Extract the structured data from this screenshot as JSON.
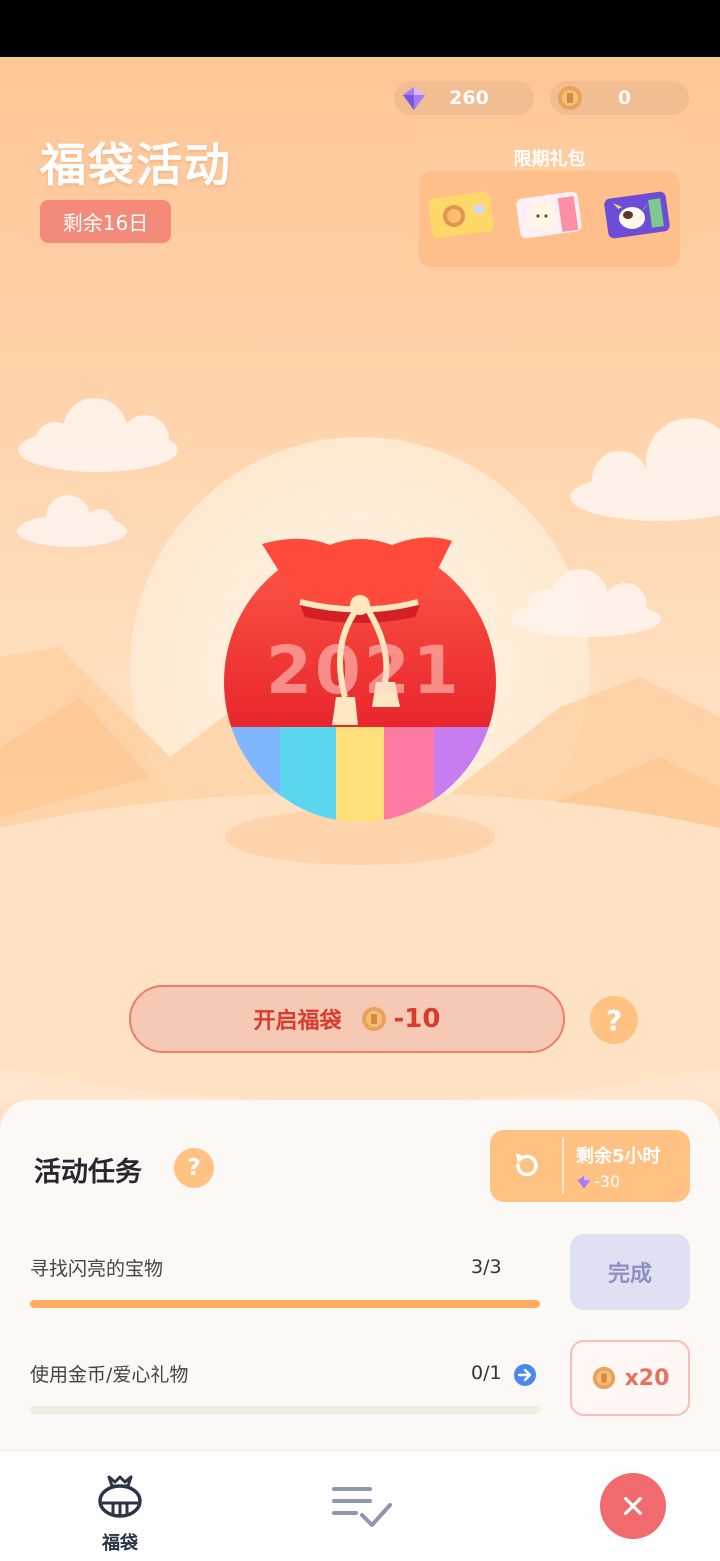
{
  "currency": {
    "gems": "260",
    "coins": "0"
  },
  "event": {
    "title": "福袋活动",
    "days_left": "剩余16日"
  },
  "gift_pack": {
    "label": "限期礼包"
  },
  "bag": {
    "year": "2021"
  },
  "open_button": {
    "label": "开启福袋",
    "cost": "-10"
  },
  "help": {
    "glyph": "?"
  },
  "tasks": {
    "title": "活动任务",
    "refresh": {
      "time_left": "剩余5小时",
      "cost": "-30"
    },
    "items": [
      {
        "name": "寻找闪亮的宝物",
        "progress": "3/3",
        "progress_ratio": 1.0,
        "action": "完成"
      },
      {
        "name": "使用金币/爱心礼物",
        "progress": "0/1",
        "progress_ratio": 0.0,
        "reward": "x20"
      }
    ]
  },
  "nav": {
    "tab1_label": "福袋",
    "close_glyph": "×"
  },
  "colors": {
    "accent": "#ffc283",
    "danger": "#f06a6e",
    "bar_fill": "#ffac5e"
  }
}
